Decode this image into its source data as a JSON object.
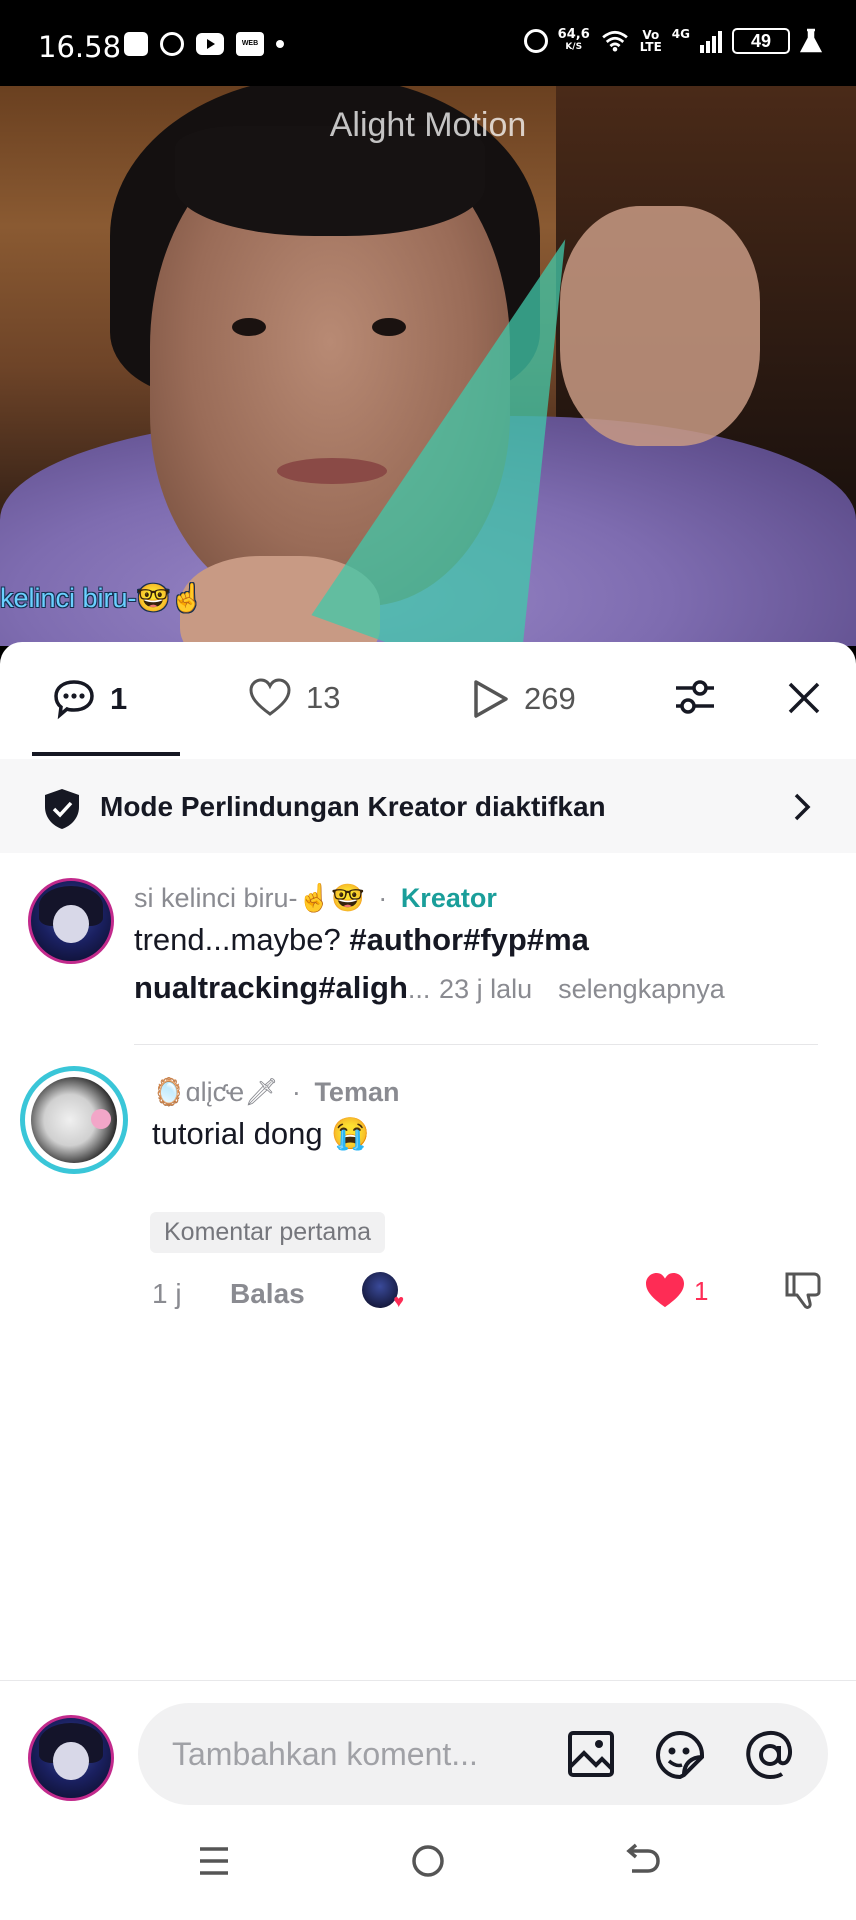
{
  "status_bar": {
    "time": "16.58",
    "net_speed_value": "64,6",
    "net_speed_unit": "K/S",
    "volte_top": "Vo",
    "volte_bottom": "LTE",
    "network": "4G",
    "battery": "49",
    "webtoon_label": "WEB TOON"
  },
  "video": {
    "watermark": "Alight Motion",
    "caption": "kelinci biru-🤓☝"
  },
  "stats": {
    "comments": "1",
    "likes": "13",
    "views": "269"
  },
  "protection_banner": {
    "text": "Mode Perlindungan Kreator diaktifkan"
  },
  "creator_comment": {
    "username": "si kelinci biru-☝🤓",
    "separator": "·",
    "role": "Kreator",
    "text_line1_plain": "trend...maybe? ",
    "text_line1_tags": "#author#fyp#ma",
    "text_line2_tags": "nualtracking#aligh",
    "ellipsis": "...",
    "time": "23 j lalu",
    "more": "selengkapnya"
  },
  "friend_comment": {
    "username": "🪞ɑlįƈҽ🗡",
    "separator": "·",
    "relation": "Teman",
    "text": "tutorial dong 😭",
    "badge": "Komentar pertama",
    "time": "1 j",
    "reply": "Balas",
    "like_count": "1"
  },
  "composer": {
    "placeholder": "Tambahkan koment..."
  },
  "colors": {
    "accent_red": "#fe2c55",
    "creator_teal": "#1a9e9a"
  }
}
